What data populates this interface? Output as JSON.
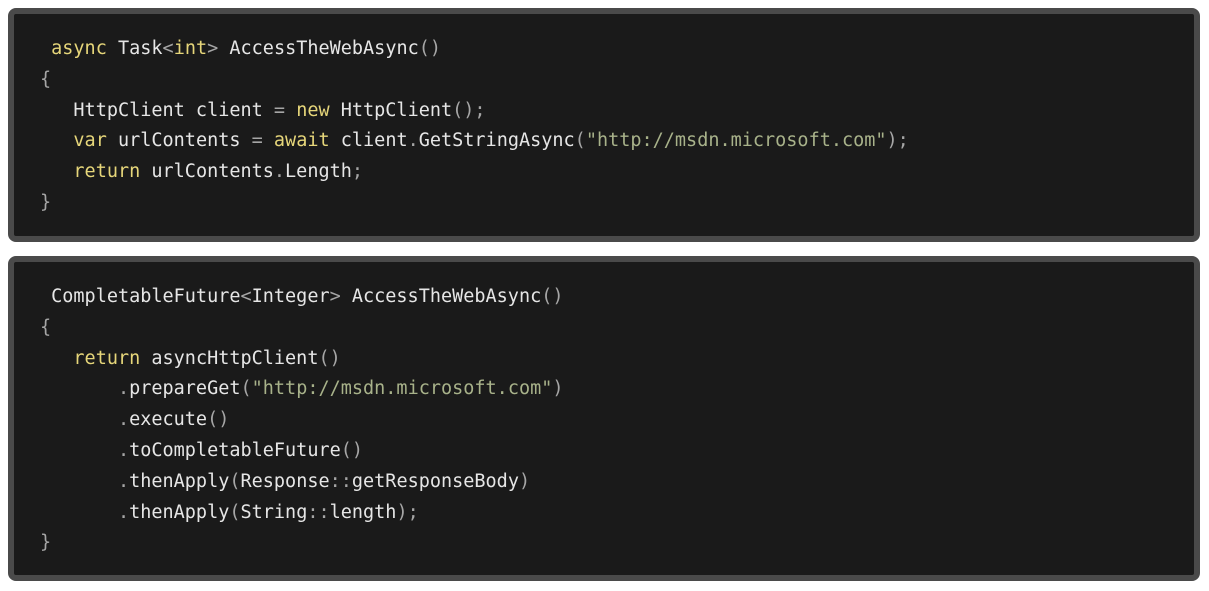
{
  "snippets": [
    {
      "language": "C#",
      "lines": [
        [
          {
            "t": " ",
            "c": "plain"
          },
          {
            "t": "async",
            "c": "kw"
          },
          {
            "t": " Task",
            "c": "plain"
          },
          {
            "t": "<",
            "c": "punct"
          },
          {
            "t": "int",
            "c": "kw"
          },
          {
            "t": ">",
            "c": "punct"
          },
          {
            "t": " AccessTheWebAsync",
            "c": "plain"
          },
          {
            "t": "()",
            "c": "punct"
          }
        ],
        [
          {
            "t": "{",
            "c": "punct"
          }
        ],
        [
          {
            "t": "   HttpClient client ",
            "c": "plain"
          },
          {
            "t": "=",
            "c": "punct"
          },
          {
            "t": " ",
            "c": "plain"
          },
          {
            "t": "new",
            "c": "kw"
          },
          {
            "t": " HttpClient",
            "c": "plain"
          },
          {
            "t": "();",
            "c": "punct"
          }
        ],
        [
          {
            "t": "   ",
            "c": "plain"
          },
          {
            "t": "var",
            "c": "kw"
          },
          {
            "t": " urlContents ",
            "c": "plain"
          },
          {
            "t": "=",
            "c": "punct"
          },
          {
            "t": " ",
            "c": "plain"
          },
          {
            "t": "await",
            "c": "kw"
          },
          {
            "t": " client",
            "c": "plain"
          },
          {
            "t": ".",
            "c": "punct"
          },
          {
            "t": "GetStringAsync",
            "c": "plain"
          },
          {
            "t": "(",
            "c": "punct"
          },
          {
            "t": "\"http://msdn.microsoft.com\"",
            "c": "str"
          },
          {
            "t": ");",
            "c": "punct"
          }
        ],
        [
          {
            "t": "   ",
            "c": "plain"
          },
          {
            "t": "return",
            "c": "kw"
          },
          {
            "t": " urlContents",
            "c": "plain"
          },
          {
            "t": ".",
            "c": "punct"
          },
          {
            "t": "Length",
            "c": "plain"
          },
          {
            "t": ";",
            "c": "punct"
          }
        ],
        [
          {
            "t": "}",
            "c": "punct"
          }
        ]
      ]
    },
    {
      "language": "Java",
      "lines": [
        [
          {
            "t": " CompletableFuture",
            "c": "plain"
          },
          {
            "t": "<",
            "c": "punct"
          },
          {
            "t": "Integer",
            "c": "plain"
          },
          {
            "t": ">",
            "c": "punct"
          },
          {
            "t": " AccessTheWebAsync",
            "c": "plain"
          },
          {
            "t": "()",
            "c": "punct"
          }
        ],
        [
          {
            "t": "{",
            "c": "punct"
          }
        ],
        [
          {
            "t": "   ",
            "c": "plain"
          },
          {
            "t": "return",
            "c": "kw"
          },
          {
            "t": " asyncHttpClient",
            "c": "plain"
          },
          {
            "t": "()",
            "c": "punct"
          }
        ],
        [
          {
            "t": "       ",
            "c": "plain"
          },
          {
            "t": ".",
            "c": "punct"
          },
          {
            "t": "prepareGet",
            "c": "plain"
          },
          {
            "t": "(",
            "c": "punct"
          },
          {
            "t": "\"http://msdn.microsoft.com\"",
            "c": "str"
          },
          {
            "t": ")",
            "c": "punct"
          }
        ],
        [
          {
            "t": "       ",
            "c": "plain"
          },
          {
            "t": ".",
            "c": "punct"
          },
          {
            "t": "execute",
            "c": "plain"
          },
          {
            "t": "()",
            "c": "punct"
          }
        ],
        [
          {
            "t": "       ",
            "c": "plain"
          },
          {
            "t": ".",
            "c": "punct"
          },
          {
            "t": "toCompletableFuture",
            "c": "plain"
          },
          {
            "t": "()",
            "c": "punct"
          }
        ],
        [
          {
            "t": "       ",
            "c": "plain"
          },
          {
            "t": ".",
            "c": "punct"
          },
          {
            "t": "thenApply",
            "c": "plain"
          },
          {
            "t": "(",
            "c": "punct"
          },
          {
            "t": "Response",
            "c": "plain"
          },
          {
            "t": "::",
            "c": "punct"
          },
          {
            "t": "getResponseBody",
            "c": "plain"
          },
          {
            "t": ")",
            "c": "punct"
          }
        ],
        [
          {
            "t": "       ",
            "c": "plain"
          },
          {
            "t": ".",
            "c": "punct"
          },
          {
            "t": "thenApply",
            "c": "plain"
          },
          {
            "t": "(",
            "c": "punct"
          },
          {
            "t": "String",
            "c": "plain"
          },
          {
            "t": "::",
            "c": "punct"
          },
          {
            "t": "length",
            "c": "plain"
          },
          {
            "t": ");",
            "c": "punct"
          }
        ],
        [
          {
            "t": "}",
            "c": "punct"
          }
        ]
      ]
    }
  ],
  "colors": {
    "background": "#1a1a1a",
    "border": "#4a4a4a",
    "keyword": "#e6d67a",
    "string": "#a8b28a",
    "punctuation": "#a6a6a6",
    "plain": "#e6e6e6"
  }
}
